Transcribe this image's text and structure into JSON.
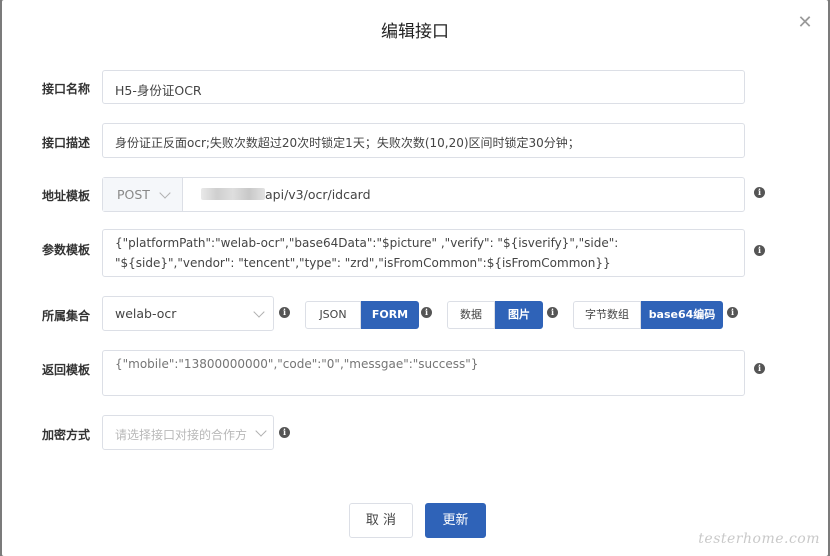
{
  "dialog": {
    "title": "编辑接口",
    "close_icon": "close-icon"
  },
  "form": {
    "name": {
      "label": "接口名称",
      "value": "H5-身份证OCR"
    },
    "description": {
      "label": "接口描述",
      "value": "身份证正反面ocr;失败次数超过20次时锁定1天；失败次数(10,20)区间时锁定30分钟；"
    },
    "address": {
      "label": "地址模板",
      "method": "POST",
      "url_suffix": "api/v3/ocr/idcard"
    },
    "params": {
      "label": "参数模板",
      "value": "{\"platformPath\":\"welab-ocr\",\"base64Data\":\"$picture\" ,\"verify\": \"${isverify}\",\"side\": \"${side}\",\"vendor\": \"tencent\",\"type\": \"zrd\",\"isFromCommon\":${isFromCommon}}"
    },
    "collection": {
      "label": "所属集合",
      "value": "welab-ocr",
      "format_options": [
        "JSON",
        "FORM"
      ],
      "format_selected": "FORM",
      "data_options": [
        "数据",
        "图片"
      ],
      "data_selected": "图片",
      "encoding_options": [
        "字节数组",
        "base64编码"
      ],
      "encoding_selected": "base64编码"
    },
    "response": {
      "label": "返回模板",
      "placeholder": "{\"mobile\":\"13800000000\",\"code\":\"0\",\"messgae\":\"success\"}"
    },
    "encryption": {
      "label": "加密方式",
      "placeholder": "请选择接口对接的合作方"
    }
  },
  "footer": {
    "cancel_label": "取 消",
    "update_label": "更新"
  },
  "watermark": "testerhome.com",
  "colors": {
    "primary": "#2f63b8",
    "border": "#dcdfe6",
    "overlay": "#7b7b7b"
  }
}
